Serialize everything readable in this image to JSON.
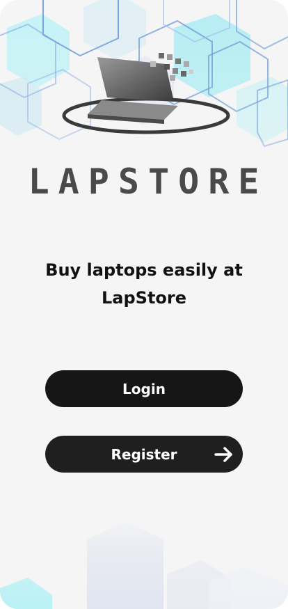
{
  "brand": {
    "name": "LAPSTORE",
    "tagline": "Buy laptops easily at LapStore"
  },
  "actions": {
    "login_label": "Login",
    "register_label": "Register"
  },
  "icons": {
    "logo": "laptop-logo-icon",
    "register_arrow": "arrow-right-icon"
  },
  "colors": {
    "background": "#f5f5f5",
    "button": "#161616",
    "accent_hex": "#7fe6f0"
  }
}
